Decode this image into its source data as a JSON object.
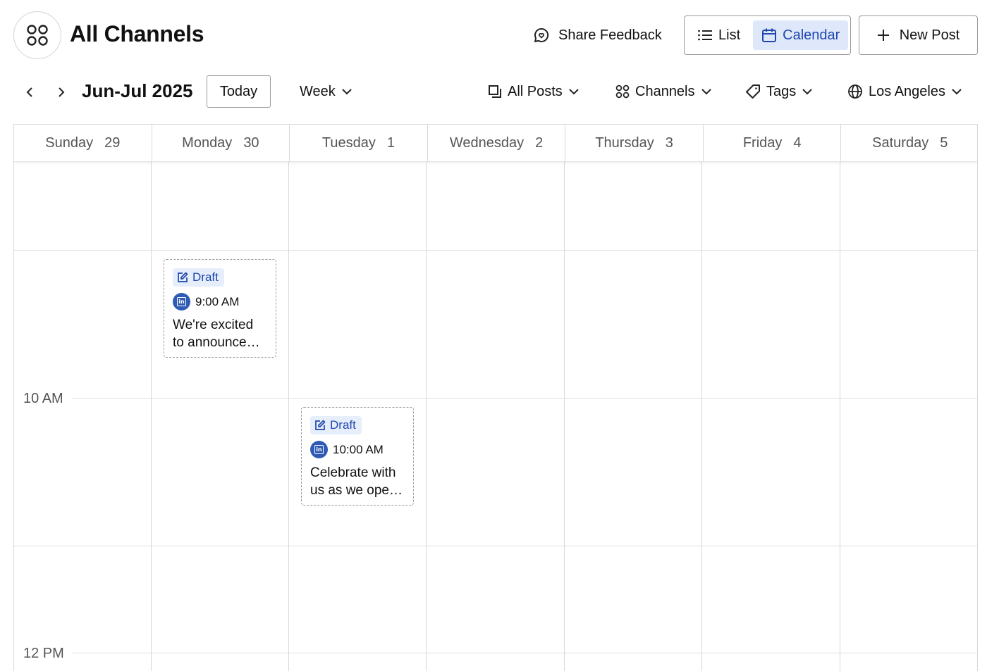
{
  "header": {
    "title": "All Channels",
    "share_feedback": "Share Feedback",
    "view_list": "List",
    "view_calendar": "Calendar",
    "new_post": "New Post"
  },
  "toolbar": {
    "range": "Jun-Jul 2025",
    "today": "Today",
    "period": "Week",
    "posts_filter": "All Posts",
    "channels_filter": "Channels",
    "tags_filter": "Tags",
    "timezone": "Los Angeles"
  },
  "days": [
    {
      "name": "Sunday",
      "date": "29"
    },
    {
      "name": "Monday",
      "date": "30"
    },
    {
      "name": "Tuesday",
      "date": "1"
    },
    {
      "name": "Wednesday",
      "date": "2"
    },
    {
      "name": "Thursday",
      "date": "3"
    },
    {
      "name": "Friday",
      "date": "4"
    },
    {
      "name": "Saturday",
      "date": "5"
    }
  ],
  "hours": [
    "10 AM",
    "12 PM"
  ],
  "posts": [
    {
      "status": "Draft",
      "time": "9:00 AM",
      "text": "We're excited to announce our newest update",
      "channel": "linkedin-icon"
    },
    {
      "status": "Draft",
      "time": "10:00 AM",
      "text": "Celebrate with us as we open our new office",
      "channel": "linkedin-icon"
    }
  ],
  "colors": {
    "accent": "#1f47ad",
    "accent_bg": "#dfe8fb",
    "linkedin": "#2f5bb5",
    "border": "#d8d8d8"
  }
}
